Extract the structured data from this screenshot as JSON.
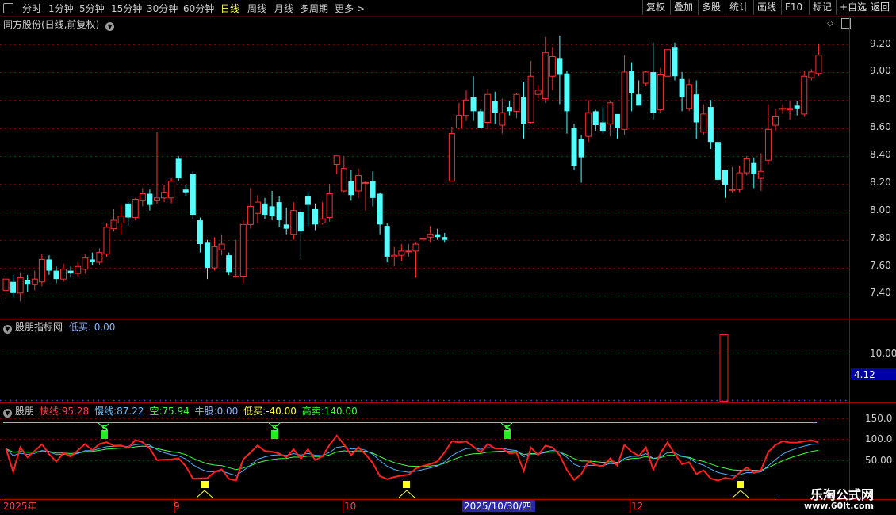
{
  "toolbar": {
    "periods": [
      "分时",
      "1分钟",
      "5分钟",
      "15分钟",
      "30分钟",
      "60分钟",
      "日线",
      "周线",
      "月线",
      "多周期",
      "更多 >"
    ],
    "active": "日线",
    "actions": [
      "复权",
      "叠加",
      "多股",
      "统计",
      "画线",
      "F10",
      "标记",
      "+自选",
      "返回"
    ]
  },
  "main": {
    "title": "同方股份(日线,前复权)",
    "y_ticks": [
      "9.20",
      "9.00",
      "8.80",
      "8.60",
      "8.40",
      "8.20",
      "8.00",
      "7.80",
      "7.60",
      "7.40"
    ]
  },
  "ind1": {
    "name": "股朋指标网",
    "low_label": "低买:",
    "low_value": "0.00",
    "y_tick": "10.00",
    "value_tag": "4.12"
  },
  "ind2": {
    "name": "股朋",
    "fast_label": "快线:",
    "fast_value": "95.28",
    "slow_label": "慢线:",
    "slow_value": "87.22",
    "empty_label": "空:",
    "empty_value": "75.94",
    "bull_label": "牛股:",
    "bull_value": "0.00",
    "low_label": "低买:",
    "low_value": "-40.00",
    "high_label": "高卖:",
    "high_value": "140.00",
    "y_ticks": [
      "150.0",
      "100.0",
      "50.00"
    ],
    "s_marker": "S"
  },
  "xaxis": {
    "labels": [
      "2025年",
      "9",
      "10",
      "12"
    ],
    "cursor_date": "2025/10/30/四"
  },
  "watermark": {
    "line1": "乐淘公式网",
    "line2": "www.60lt.com"
  },
  "colors": {
    "up": "#ff3030",
    "down": "#54ffff",
    "grid": "#7a0000",
    "fast": "#ff2020",
    "slow": "#50b0ff",
    "empty": "#40ff40"
  },
  "chart_data": {
    "type": "candlestick",
    "title": "同方股份(日线,前复权)",
    "ylim": [
      7.3,
      9.3
    ],
    "series": [
      {
        "values": [
          [
            7.44,
            7.52,
            7.56,
            7.38
          ],
          [
            7.5,
            7.42,
            7.55,
            7.39
          ],
          [
            7.42,
            7.53,
            7.57,
            7.36
          ],
          [
            7.51,
            7.48,
            7.55,
            7.43
          ],
          [
            7.48,
            7.52,
            7.58,
            7.44
          ],
          [
            7.5,
            7.66,
            7.7,
            7.47
          ],
          [
            7.66,
            7.58,
            7.69,
            7.55
          ],
          [
            7.58,
            7.52,
            7.61,
            7.49
          ],
          [
            7.52,
            7.59,
            7.63,
            7.5
          ],
          [
            7.58,
            7.56,
            7.61,
            7.53
          ],
          [
            7.56,
            7.61,
            7.64,
            7.54
          ],
          [
            7.59,
            7.67,
            7.7,
            7.56
          ],
          [
            7.66,
            7.64,
            7.71,
            7.62
          ],
          [
            7.64,
            7.71,
            7.74,
            7.62
          ],
          [
            7.7,
            7.89,
            7.92,
            7.68
          ],
          [
            7.88,
            7.94,
            8.02,
            7.86
          ],
          [
            7.92,
            7.97,
            8.05,
            7.84
          ],
          [
            8.06,
            7.96,
            8.07,
            7.9
          ],
          [
            7.96,
            8.09,
            8.1,
            7.94
          ],
          [
            8.08,
            8.13,
            8.17,
            8.04
          ],
          [
            8.13,
            8.05,
            8.16,
            8.01
          ],
          [
            8.08,
            8.1,
            8.57,
            8.06
          ],
          [
            8.1,
            8.14,
            8.19,
            8.07
          ],
          [
            8.1,
            8.22,
            8.24,
            8.06
          ],
          [
            8.38,
            8.24,
            8.4,
            8.22
          ],
          [
            8.16,
            8.14,
            8.19,
            8.11
          ],
          [
            8.27,
            7.98,
            8.29,
            7.95
          ],
          [
            7.94,
            7.77,
            7.96,
            7.71
          ],
          [
            7.78,
            7.6,
            7.8,
            7.52
          ],
          [
            7.6,
            7.75,
            7.82,
            7.58
          ],
          [
            7.73,
            7.77,
            7.84,
            7.69
          ],
          [
            7.69,
            7.57,
            7.71,
            7.55
          ],
          [
            7.54,
            7.54,
            7.8,
            7.53
          ],
          [
            7.54,
            7.91,
            7.94,
            7.49
          ],
          [
            7.91,
            8.04,
            8.17,
            7.88
          ],
          [
            7.99,
            8.07,
            8.12,
            7.92
          ],
          [
            8.06,
            7.98,
            8.1,
            7.95
          ],
          [
            8.04,
            7.97,
            8.15,
            7.94
          ],
          [
            8.07,
            7.94,
            8.11,
            7.89
          ],
          [
            7.91,
            7.88,
            8.03,
            7.84
          ],
          [
            7.84,
            8.01,
            8.07,
            7.8
          ],
          [
            8.0,
            7.86,
            8.02,
            7.66
          ],
          [
            8.11,
            8.05,
            8.14,
            7.9
          ],
          [
            8.02,
            7.91,
            8.06,
            7.87
          ],
          [
            7.92,
            7.95,
            8.07,
            7.91
          ],
          [
            7.96,
            8.13,
            8.2,
            7.93
          ],
          [
            8.34,
            8.4,
            8.34,
            8.27
          ],
          [
            8.15,
            8.31,
            8.4,
            8.14
          ],
          [
            8.22,
            8.12,
            8.3,
            8.08
          ],
          [
            8.15,
            8.26,
            8.31,
            8.1
          ],
          [
            8.21,
            8.21,
            8.22,
            8.01
          ],
          [
            8.22,
            8.1,
            8.29,
            8.04
          ],
          [
            8.13,
            7.91,
            8.14,
            7.84
          ],
          [
            7.9,
            7.68,
            7.92,
            7.64
          ],
          [
            7.68,
            7.69,
            7.75,
            7.61
          ],
          [
            7.69,
            7.72,
            7.77,
            7.65
          ],
          [
            7.72,
            7.72,
            7.77,
            7.68
          ],
          [
            7.72,
            7.77,
            7.78,
            7.53
          ],
          [
            7.81,
            7.81,
            7.83,
            7.78
          ],
          [
            7.82,
            7.84,
            7.9,
            7.78
          ],
          [
            7.84,
            7.82,
            7.88,
            7.8
          ],
          [
            7.82,
            7.8,
            7.85,
            7.78
          ],
          [
            8.22,
            8.56,
            8.61,
            8.22
          ],
          [
            8.6,
            8.69,
            8.78,
            8.59
          ],
          [
            8.69,
            8.8,
            8.87,
            8.65
          ],
          [
            8.82,
            8.72,
            8.97,
            8.65
          ],
          [
            8.72,
            8.6,
            8.74,
            8.6
          ],
          [
            8.64,
            8.84,
            8.88,
            8.59
          ],
          [
            8.79,
            8.71,
            8.86,
            8.63
          ],
          [
            8.62,
            8.71,
            8.81,
            8.56
          ],
          [
            8.75,
            8.72,
            8.79,
            8.69
          ],
          [
            8.72,
            8.84,
            8.85,
            8.67
          ],
          [
            8.82,
            8.63,
            8.93,
            8.52
          ],
          [
            8.64,
            8.97,
            9.08,
            8.63
          ],
          [
            8.84,
            8.87,
            8.91,
            8.81
          ],
          [
            8.81,
            9.14,
            9.25,
            8.78
          ],
          [
            8.97,
            9.11,
            9.18,
            8.87
          ],
          [
            9.1,
            8.98,
            9.26,
            8.77
          ],
          [
            8.99,
            8.72,
            9.01,
            8.56
          ],
          [
            8.6,
            8.33,
            8.63,
            8.3
          ],
          [
            8.52,
            8.39,
            8.55,
            8.21
          ],
          [
            8.54,
            8.71,
            8.8,
            8.5
          ],
          [
            8.72,
            8.62,
            8.73,
            8.58
          ],
          [
            8.64,
            8.58,
            8.75,
            8.56
          ],
          [
            8.63,
            8.78,
            8.79,
            8.54
          ],
          [
            8.7,
            8.6,
            8.65,
            8.52
          ],
          [
            8.59,
            9.0,
            9.12,
            8.55
          ],
          [
            9.01,
            8.85,
            9.07,
            8.72
          ],
          [
            8.84,
            8.76,
            8.94,
            8.76
          ],
          [
            8.92,
            9.0,
            9.01,
            8.9
          ],
          [
            9.0,
            8.71,
            9.21,
            8.66
          ],
          [
            8.73,
            8.98,
            9.03,
            8.71
          ],
          [
            8.97,
            9.16,
            9.16,
            9.08
          ],
          [
            9.18,
            8.97,
            9.21,
            8.94
          ],
          [
            8.95,
            8.82,
            9.0,
            8.72
          ],
          [
            8.74,
            8.91,
            8.95,
            8.72
          ],
          [
            8.84,
            8.64,
            8.94,
            8.52
          ],
          [
            8.57,
            8.7,
            8.77,
            8.55
          ],
          [
            8.75,
            8.5,
            8.8,
            8.45
          ],
          [
            8.5,
            8.23,
            8.59,
            8.21
          ],
          [
            8.3,
            8.19,
            8.26,
            8.1
          ],
          [
            8.16,
            8.16,
            8.32,
            8.14
          ],
          [
            8.16,
            8.28,
            8.33,
            8.14
          ],
          [
            8.28,
            8.38,
            8.4,
            8.26
          ],
          [
            8.35,
            8.27,
            8.39,
            8.17
          ],
          [
            8.24,
            8.29,
            8.42,
            8.15
          ],
          [
            8.37,
            8.59,
            8.77,
            8.34
          ],
          [
            8.62,
            8.68,
            8.74,
            8.58
          ],
          [
            8.74,
            8.74,
            8.77,
            8.7
          ],
          [
            8.73,
            8.74,
            8.79,
            8.66
          ],
          [
            8.76,
            8.74,
            8.79,
            8.69
          ],
          [
            8.7,
            8.97,
            9.01,
            8.68
          ],
          [
            8.96,
            9.0,
            9.02,
            8.94
          ],
          [
            8.99,
            9.12,
            9.2,
            8.97
          ]
        ]
      }
    ]
  }
}
